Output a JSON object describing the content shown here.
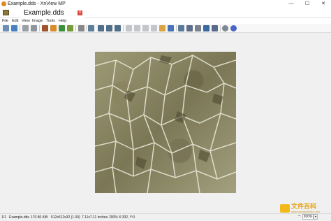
{
  "window": {
    "title": "Example.dds - XnView MP",
    "controls": {
      "minimize": "—",
      "maximize": "☐",
      "close": "✕"
    }
  },
  "tab": {
    "label": "Example.dds",
    "close": "x"
  },
  "menu": [
    "File",
    "Edit",
    "View",
    "Image",
    "Tools",
    "Help"
  ],
  "toolbar": {
    "icons": [
      "browser-icon",
      "fullscreen-icon",
      "open-icon",
      "save-icon",
      "print-icon",
      "slideshow-icon",
      "web-icon",
      "refresh-icon",
      "histogram-icon",
      "zoom-in-icon",
      "zoom-out-icon",
      "zoom-fit-icon",
      "prev-icon",
      "next-icon",
      "first-icon",
      "last-icon",
      "rotate-left-icon",
      "rotate-right-icon",
      "crop-icon",
      "resize-icon",
      "adjust-icon",
      "effects-icon",
      "print2-icon",
      "capture-icon",
      "fullscreen2-icon",
      "settings-icon",
      "help-icon"
    ]
  },
  "status": {
    "index": "1/1",
    "filename": "Example.dds",
    "size": "170.80 KiB",
    "dimensions": "512x512x32 (1.00)",
    "physical": "7.11x7.11 inches",
    "zoom_pct": "200%",
    "coords": "X:332, Y:0",
    "zoom_box": "200%"
  },
  "watermark": {
    "text": "文件百科",
    "sub": "www.wenjianbaike.com"
  },
  "colors": {
    "accent": "#e08a1e",
    "tab_close": "#e0463a",
    "texture": "#8a8662"
  }
}
